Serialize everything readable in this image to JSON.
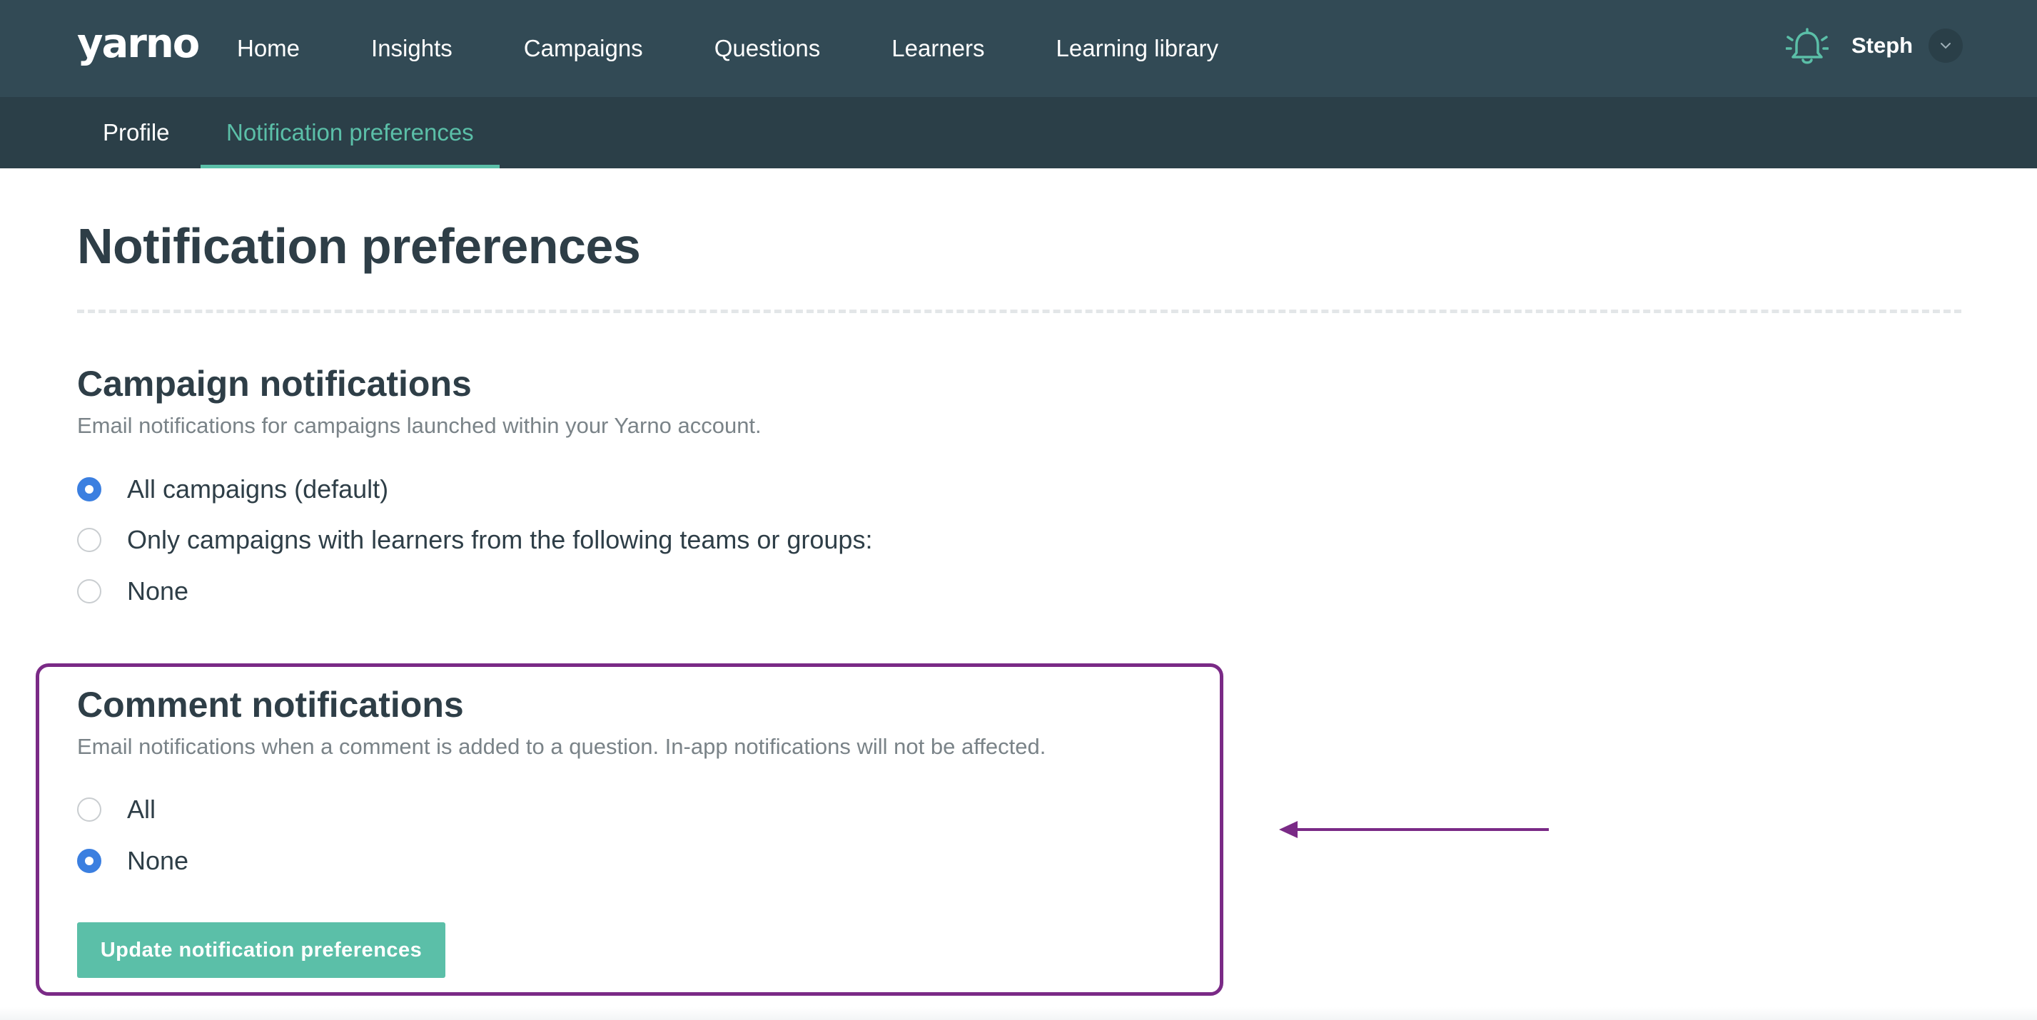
{
  "brand": {
    "logo": "yarno",
    "accent": "#5bbfa8",
    "header_bg": "#324a55",
    "highlight": "#7a2a86",
    "radio_checked": "#3b7fe0"
  },
  "nav": {
    "items": [
      {
        "label": "Home"
      },
      {
        "label": "Insights"
      },
      {
        "label": "Campaigns"
      },
      {
        "label": "Questions"
      },
      {
        "label": "Learners"
      },
      {
        "label": "Learning library"
      }
    ],
    "bell_icon": "bell-icon",
    "user": {
      "name": "Steph",
      "menu_icon": "chevron-down-icon"
    }
  },
  "subnav": {
    "tabs": [
      {
        "label": "Profile",
        "active": false
      },
      {
        "label": "Notification preferences",
        "active": true
      }
    ]
  },
  "page": {
    "title": "Notification preferences"
  },
  "campaign": {
    "title": "Campaign notifications",
    "description": "Email notifications for campaigns launched within your Yarno account.",
    "options": [
      {
        "label": "All campaigns (default)",
        "checked": true
      },
      {
        "label": "Only campaigns with learners from the following teams or groups:",
        "checked": false
      },
      {
        "label": "None",
        "checked": false
      }
    ]
  },
  "comment": {
    "title": "Comment notifications",
    "description": "Email notifications when a comment is added to a question. In-app notifications will not be affected.",
    "options": [
      {
        "label": "All",
        "checked": false
      },
      {
        "label": "None",
        "checked": true
      }
    ]
  },
  "actions": {
    "update_label": "Update notification preferences"
  }
}
